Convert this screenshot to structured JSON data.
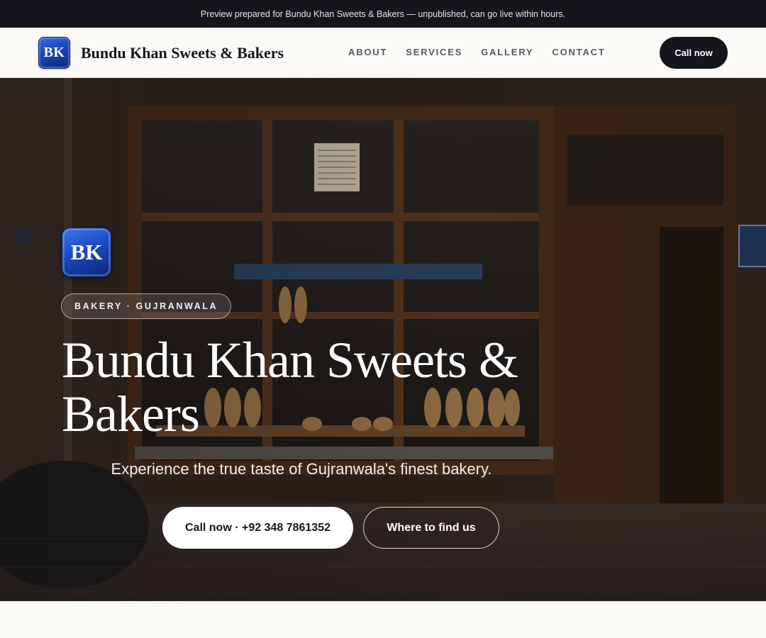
{
  "announcement": "Preview prepared for Bundu Khan Sweets & Bakers — unpublished, can go live within hours.",
  "header": {
    "logo_initials": "BK",
    "brand_name": "Bundu Khan Sweets & Bakers",
    "nav": [
      "ABOUT",
      "SERVICES",
      "GALLERY",
      "CONTACT"
    ],
    "cta_label": "Call now"
  },
  "hero": {
    "logo_initials": "BK",
    "chip": "BAKERY · GUJRANWALA",
    "title": "Bundu Khan Sweets & Bakers",
    "subtitle": "Experience the true taste of Gujranwala's finest bakery.",
    "primary_button": "Call now · +92 348 7861352",
    "secondary_button": "Where to find us",
    "background_image": "bakery-storefront-photo"
  },
  "colors": {
    "topbar": "#14161c",
    "header_bg": "#fbfaf7",
    "logo_blue": "#1b44b8",
    "dark_button": "#14161c",
    "page_bg": "#faf9f6"
  }
}
